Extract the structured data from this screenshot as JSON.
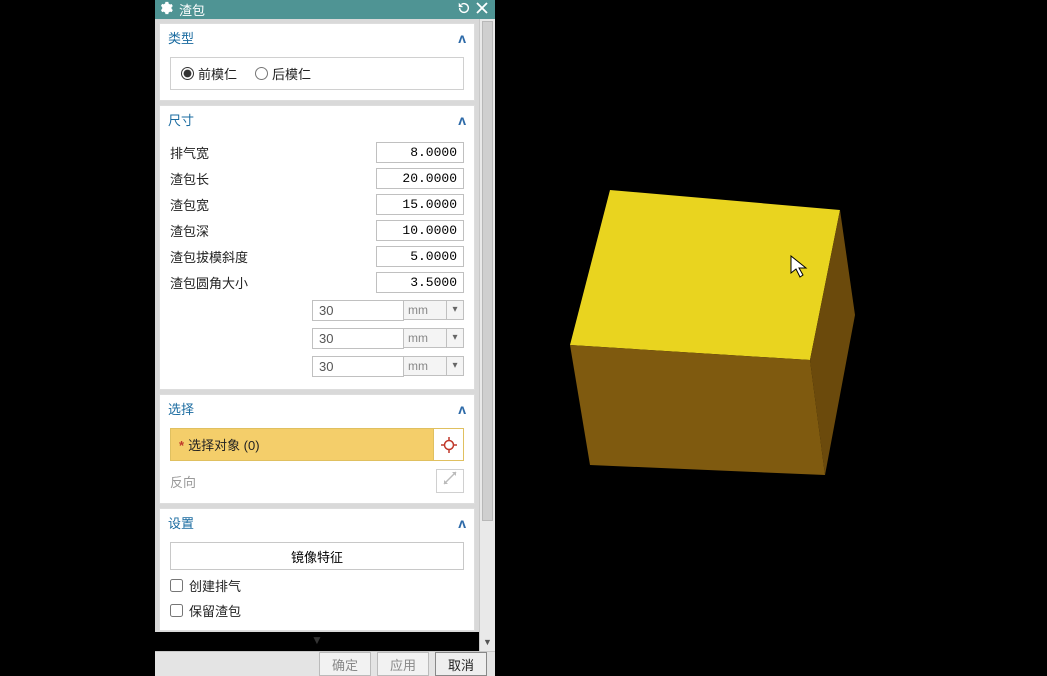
{
  "titlebar": {
    "title": "渣包"
  },
  "sections": {
    "type": {
      "header": "类型",
      "opt_front": "前模仁",
      "opt_back": "后模仁",
      "selected": "front"
    },
    "size": {
      "header": "尺寸",
      "rows": [
        {
          "label": "排气宽",
          "value": "8.0000"
        },
        {
          "label": "渣包长",
          "value": "20.0000"
        },
        {
          "label": "渣包宽",
          "value": "15.0000"
        },
        {
          "label": "渣包深",
          "value": "10.0000"
        },
        {
          "label": "渣包拔模斜度",
          "value": "5.0000"
        },
        {
          "label": "渣包圆角大小",
          "value": "3.5000"
        }
      ],
      "unit_rows": [
        {
          "value": "30",
          "unit": "mm"
        },
        {
          "value": "30",
          "unit": "mm"
        },
        {
          "value": "30",
          "unit": "mm"
        }
      ]
    },
    "select": {
      "header": "选择",
      "label_prefix": "选择对象",
      "count": 0,
      "reverse_label": "反向"
    },
    "settings": {
      "header": "设置",
      "mirror_btn": "镜像特征",
      "chk_create_vent": "创建排气",
      "chk_keep_slag": "保留渣包"
    }
  },
  "footer": {
    "ok": "确定",
    "apply": "应用",
    "cancel": "取消"
  }
}
